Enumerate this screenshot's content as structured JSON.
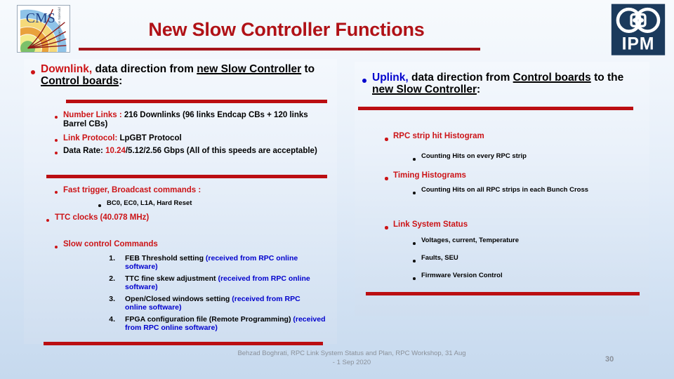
{
  "slide": {
    "title": "New Slow Controller Functions",
    "page_number": "30",
    "footer": "Behzad Boghrati, RPC Link System Status and Plan, RPC Workshop, 31 Aug - 1 Sep  2020",
    "colors": {
      "title_red": "#b01116",
      "accent_red": "#cc1417",
      "rule_red": "#bb0e12",
      "link_blue": "#0000cd",
      "body_black": "#000000",
      "background_top": "#f7fafd",
      "background_bottom": "#c6d9ee",
      "ipm_navy": "#1b3a5c"
    }
  },
  "logos": {
    "left": {
      "name": "CMS",
      "caption": "CMS"
    },
    "right": {
      "name": "IPM",
      "caption": "IPM"
    }
  },
  "left_panel": {
    "heading": {
      "lead": "Downlink,",
      "rest_a": " data direction from ",
      "u1": "new Slow Controller",
      "mid": " to ",
      "u2": "Control boards",
      "tail": ":"
    },
    "group1": [
      {
        "label": "Number Links : ",
        "value": "216 Downlinks (96 links Endcap CBs + 120 links Barrel CBs)"
      },
      {
        "label": "Link Protocol: ",
        "value": "LpGBT Protocol"
      },
      {
        "label_black": "Data Rate:  ",
        "value_red": "10.24",
        "value_black": "/5.12/2.56 Gbps  (All of this speeds are acceptable)"
      }
    ],
    "group2": {
      "bullet1": "Fast trigger, Broadcast commands :",
      "sub1": "BC0, EC0, L1A, Hard Reset",
      "bullet2": "TTC clocks (40.078 MHz)"
    },
    "group3": {
      "bullet": "Slow control Commands",
      "items": [
        {
          "n": "1.",
          "black": "FEB Threshold setting ",
          "blue": "(received from RPC online software)"
        },
        {
          "n": "2.",
          "black": "TTC fine skew adjustment ",
          "blue": "(received from RPC online software)"
        },
        {
          "n": "3.",
          "black": "Open/Closed windows setting ",
          "blue": "(received from RPC online software)"
        },
        {
          "n": "4.",
          "black": "FPGA configuration file (Remote Programming) ",
          "blue": "(received from RPC online software)"
        }
      ]
    }
  },
  "right_panel": {
    "heading": {
      "lead": "Uplink,",
      "rest_a": " data direction from ",
      "u1": "Control boards",
      "mid": " to the ",
      "u2": "new Slow Controller",
      "tail": ":"
    },
    "items": [
      {
        "title": "RPC strip hit Histogram",
        "subs": [
          "Counting Hits on every RPC strip"
        ]
      },
      {
        "title": "Timing Histograms",
        "subs": [
          "Counting Hits on all RPC strips in each Bunch Cross"
        ]
      },
      {
        "title": "Link System Status",
        "subs": [
          "Voltages, current, Temperature",
          "Faults, SEU",
          "Firmware Version Control"
        ]
      }
    ]
  }
}
